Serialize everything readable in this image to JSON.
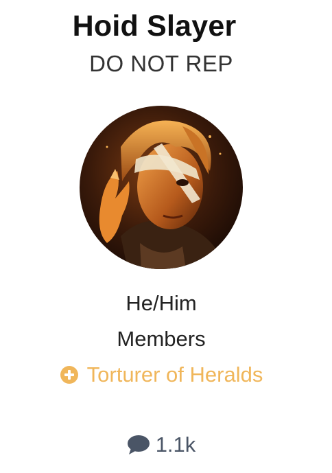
{
  "profile": {
    "username": "Hoid Slayer",
    "title": "DO NOT REP",
    "pronouns": "He/Him",
    "group": "Members",
    "award": {
      "label": "Torturer of Heralds",
      "icon": "plus-circle-icon",
      "color": "#f0b65a"
    },
    "stats": {
      "comment_icon": "comment-icon",
      "count": "1.1k",
      "icon_color": "#4a5566"
    }
  }
}
